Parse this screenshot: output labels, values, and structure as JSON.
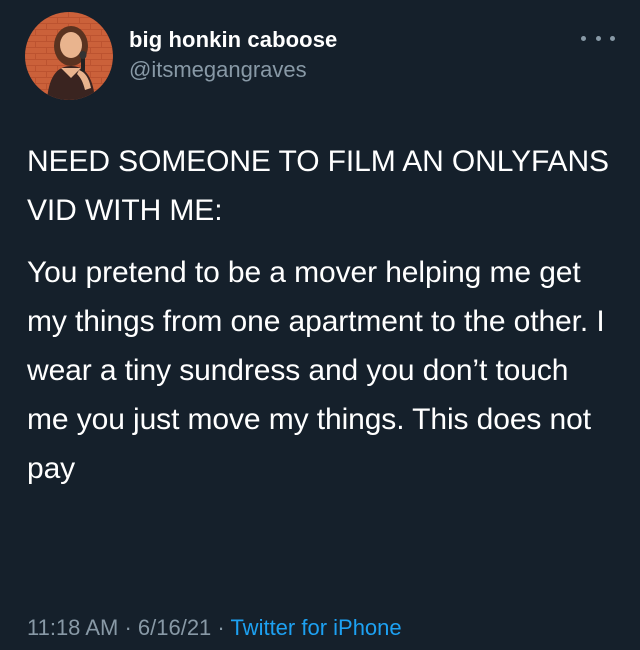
{
  "author": {
    "display_name": "big honkin caboose",
    "handle": "@itsmegangraves"
  },
  "more_menu": {
    "icon": "more-horizontal-icon"
  },
  "tweet": {
    "paragraphs": [
      "NEED SOMEONE TO FILM AN ONLYFANS VID WITH ME:",
      "You pretend to be a mover helping me get my things from one apartment to the other. I wear a tiny sundress and you don’t touch me you just move my things. This does not pay"
    ]
  },
  "meta": {
    "time": "11:18 AM",
    "separator_1": " · ",
    "date": "6/16/21",
    "separator_2": " · ",
    "source": "Twitter for iPhone"
  },
  "colors": {
    "background": "#15202b",
    "text_primary": "#ffffff",
    "text_secondary": "#8899a6",
    "link": "#1da1f2"
  }
}
